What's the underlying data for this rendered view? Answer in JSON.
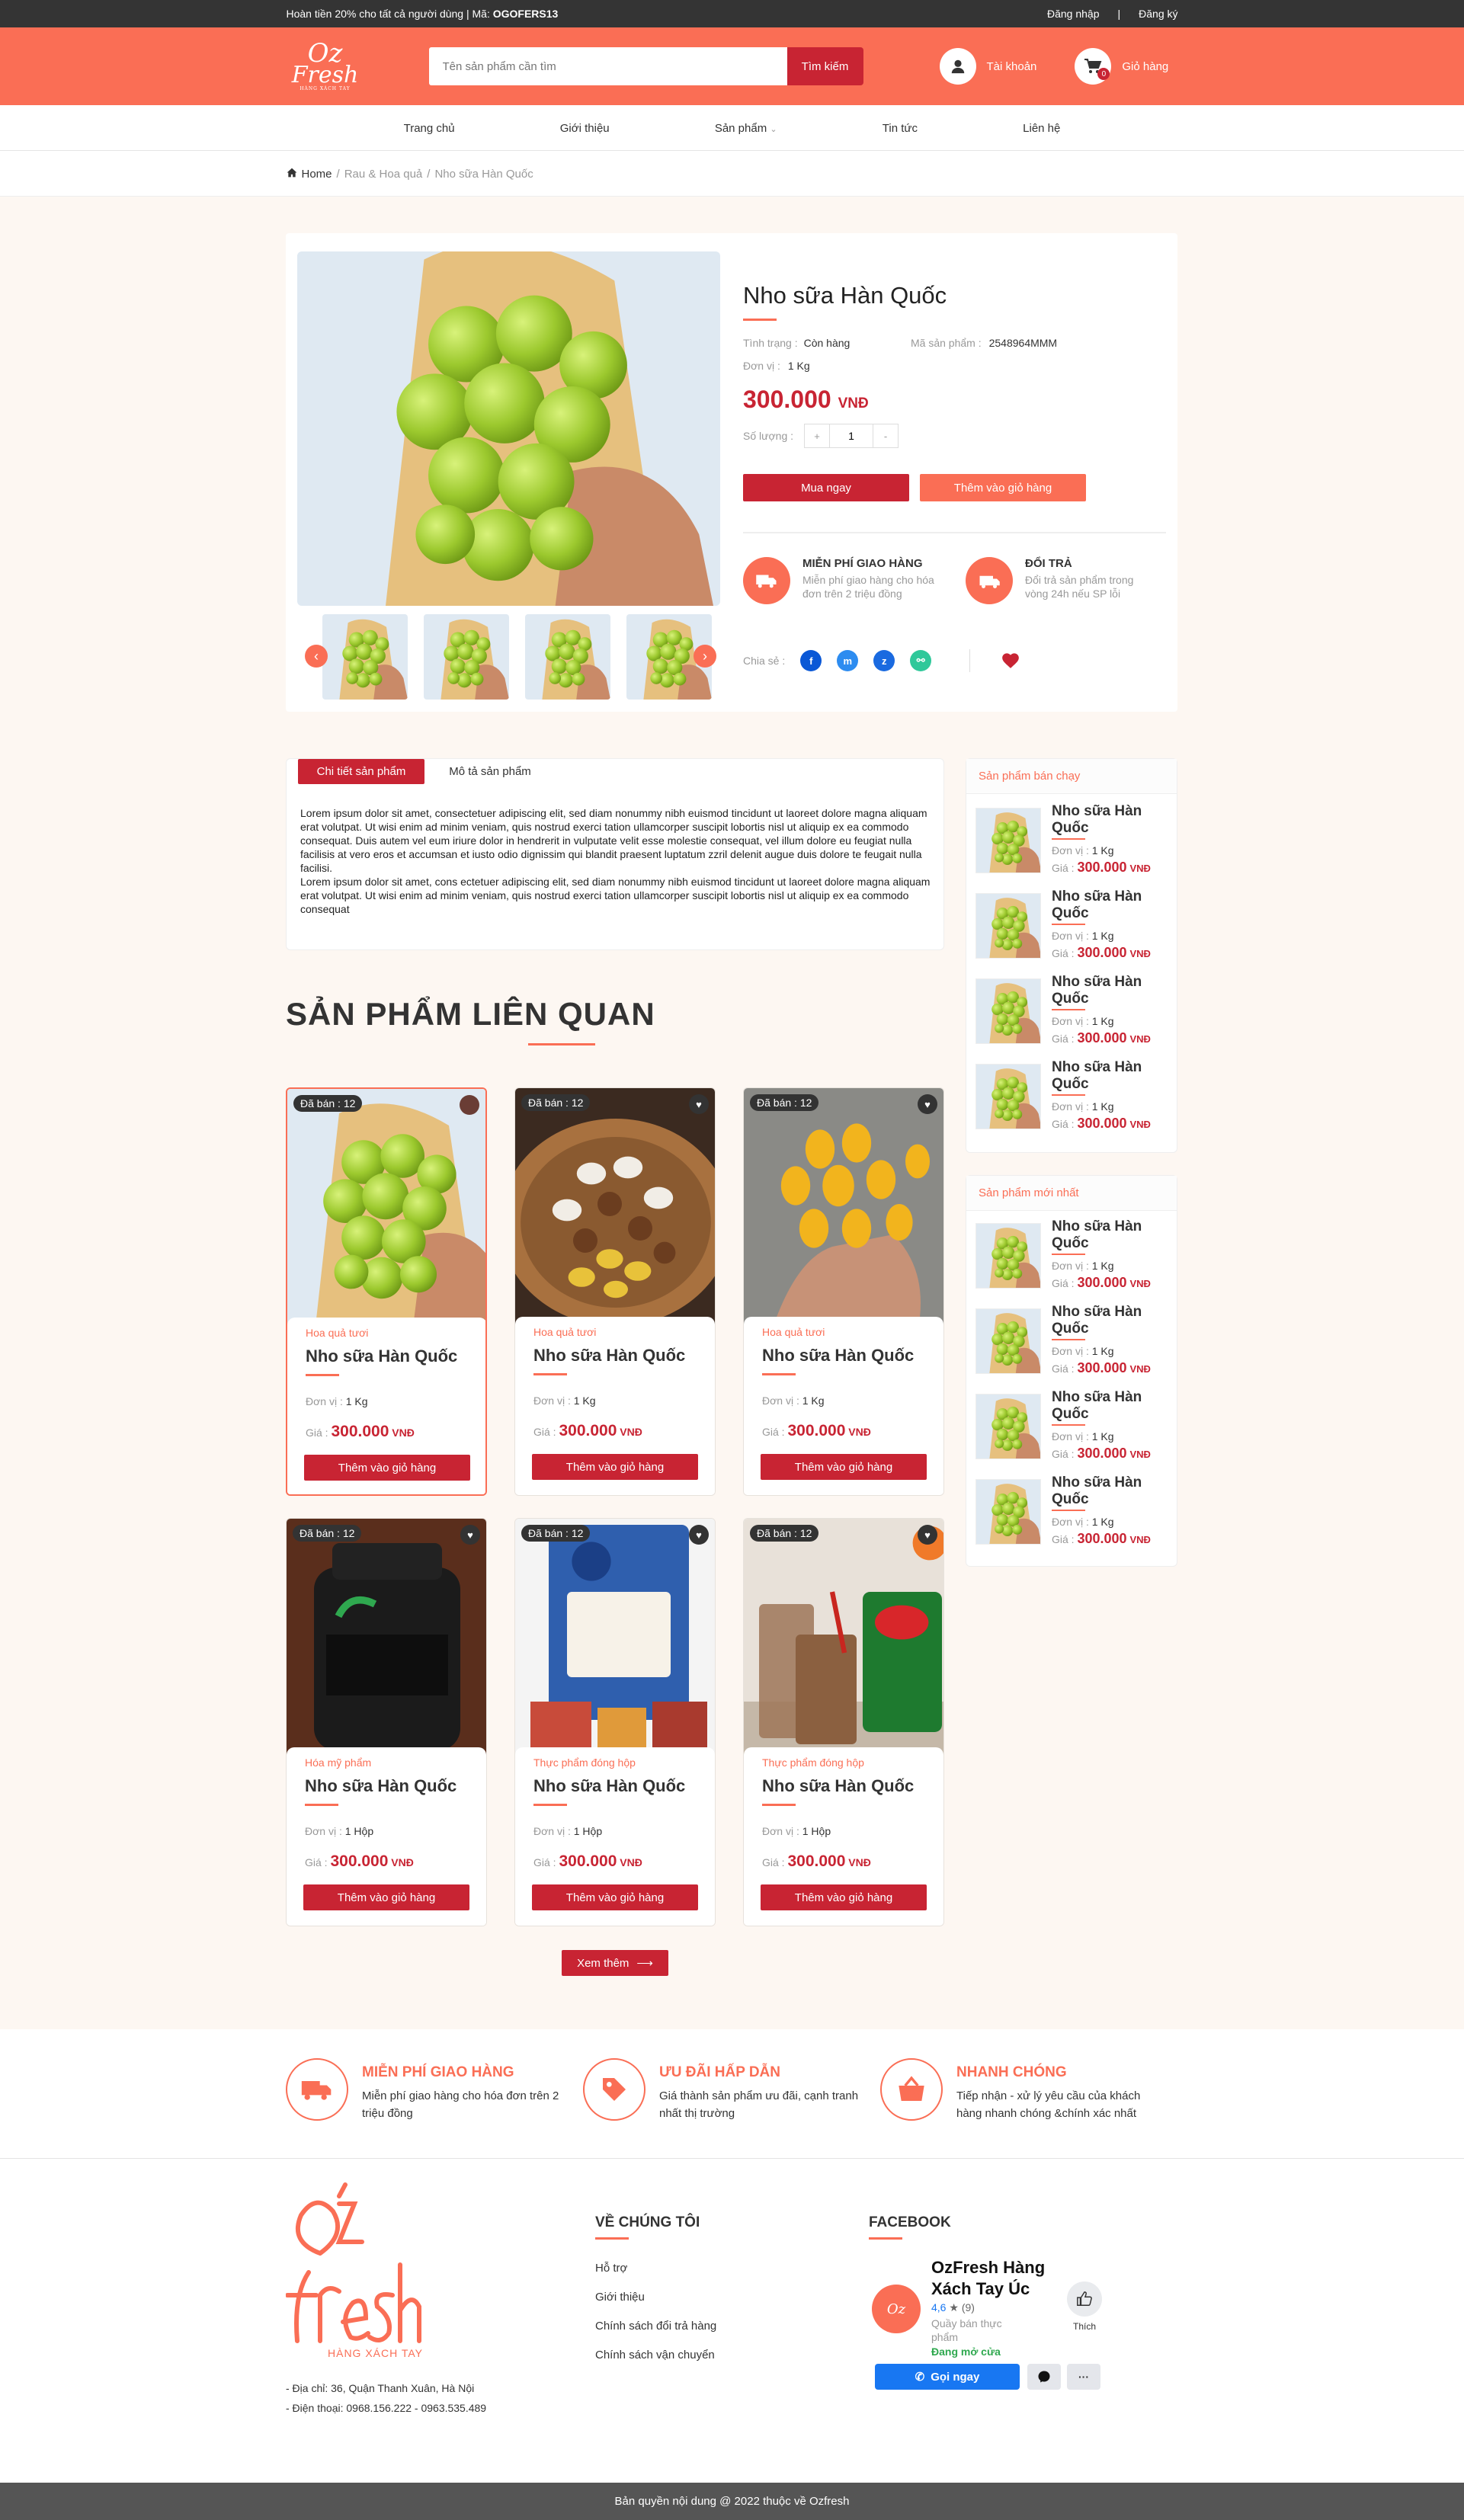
{
  "topbar": {
    "promo_text": "Hoàn tiền 20% cho tất cả người dùng | Mã: ",
    "promo_code": "OGOFERS13",
    "login": "Đăng nhập",
    "separator": "|",
    "register": "Đăng ký"
  },
  "header": {
    "logo_oz": "Oz",
    "logo_fresh": "Fresh",
    "logo_tag": "HÀNG XÁCH TAY",
    "search_placeholder": "Tên sản phẩm cần tìm",
    "search_button": "Tìm kiếm",
    "account": "Tài khoản",
    "cart": "Giỏ hàng",
    "cart_count": "0"
  },
  "nav": {
    "items": [
      "Trang chủ",
      "Giới thiệu",
      "Sản phẩm",
      "Tin tức",
      "Liên hệ"
    ],
    "dropdown_caret": "⌄"
  },
  "breadcrumb": {
    "home": "Home",
    "sep": "/",
    "category": "Rau & Hoa quả",
    "current": "Nho sữa Hàn Quốc"
  },
  "product": {
    "name": "Nho sữa Hàn Quốc",
    "status_label": "Tình trạng :",
    "status_value": "Còn hàng",
    "sku_label": "Mã sản phẩm :",
    "sku_value": "2548964MMM",
    "unit_label": "Đơn vị :",
    "unit_value": "1 Kg",
    "price": "300.000",
    "currency": "VNĐ",
    "qty_label": "Số lượng :",
    "qty_minus": "+",
    "qty_value": "1",
    "qty_plus": "-",
    "buy_now": "Mua ngay",
    "add_to_cart": "Thêm vào giỏ hàng",
    "feature1_title": "MIỄN PHÍ GIAO HÀNG",
    "feature1_desc": "Miễn phí giao hàng cho hóa đơn trên 2 triệu đồng",
    "feature2_title": "ĐỔI TRẢ",
    "feature2_desc": "Đổi trả sản phẩm trong vòng 24h nếu SP lỗi",
    "share_label": "Chia sẻ :",
    "share_icons": [
      "f",
      "m",
      "z",
      "⚯"
    ]
  },
  "tabs": {
    "detail": "Chi tiết sản phẩm",
    "description": "Mô tả sản phẩm",
    "text": "Lorem ipsum dolor sit amet, consectetuer adipiscing elit, sed diam nonummy nibh euismod tincidunt ut laoreet dolore magna aliquam erat volutpat. Ut wisi enim ad minim veniam, quis nostrud exerci tation ullamcorper suscipit lobortis nisl ut aliquip ex ea commodo consequat. Duis autem vel eum iriure dolor in hendrerit in vulputate velit esse molestie consequat, vel illum dolore eu feugiat nulla facilisis at vero eros et accumsan et iusto odio dignissim qui blandit praesent luptatum zzril delenit augue duis dolore te feugait nulla facilisi.",
    "text2": "Lorem ipsum dolor sit amet, cons ectetuer adipiscing elit, sed diam nonummy nibh euismod tincidunt ut laoreet dolore magna aliquam erat volutpat. Ut wisi enim ad minim veniam, quis nostrud exerci tation ullamcorper suscipit lobortis nisl ut aliquip ex ea commodo consequat"
  },
  "related": {
    "title": "SẢN PHẨM LIÊN QUAN",
    "items": [
      {
        "sold": "Đã bán : 12",
        "category": "Hoa quả tươi",
        "name": "Nho sữa Hàn Quốc",
        "unit_label": "Đơn vị :",
        "unit": "1 Kg",
        "price_label": "Giá :",
        "price": "300.000",
        "currency": "VNĐ",
        "button": "Thêm vào giỏ hàng"
      },
      {
        "sold": "Đã bán : 12",
        "category": "Hoa quả tươi",
        "name": "Nho sữa Hàn Quốc",
        "unit_label": "Đơn vị :",
        "unit": "1 Kg",
        "price_label": "Giá :",
        "price": "300.000",
        "currency": "VNĐ",
        "button": "Thêm vào giỏ hàng"
      },
      {
        "sold": "Đã bán : 12",
        "category": "Hoa quả tươi",
        "name": "Nho sữa Hàn Quốc",
        "unit_label": "Đơn vị :",
        "unit": "1 Kg",
        "price_label": "Giá :",
        "price": "300.000",
        "currency": "VNĐ",
        "button": "Thêm vào giỏ hàng"
      },
      {
        "sold": "Đã bán : 12",
        "category": "Hóa mỹ phẩm",
        "name": "Nho sữa Hàn Quốc",
        "unit_label": "Đơn vị :",
        "unit": "1 Hộp",
        "price_label": "Giá :",
        "price": "300.000",
        "currency": "VNĐ",
        "button": "Thêm vào giỏ hàng"
      },
      {
        "sold": "Đã bán : 12",
        "category": "Thực phẩm đóng hộp",
        "name": "Nho sữa Hàn Quốc",
        "unit_label": "Đơn vị :",
        "unit": "1 Hộp",
        "price_label": "Giá :",
        "price": "300.000",
        "currency": "VNĐ",
        "button": "Thêm vào giỏ hàng"
      },
      {
        "sold": "Đã bán : 12",
        "category": "Thực phẩm đóng hộp",
        "name": "Nho sữa Hàn Quốc",
        "unit_label": "Đơn vị :",
        "unit": "1 Hộp",
        "price_label": "Giá :",
        "price": "300.000",
        "currency": "VNĐ",
        "button": "Thêm vào giỏ hàng"
      }
    ],
    "more": "Xem thêm"
  },
  "sidebar": {
    "bestseller_title": "Sản phẩm bán chạy",
    "newest_title": "Sản phẩm mới nhất",
    "item": {
      "name": "Nho sữa Hàn Quốc",
      "unit_label": "Đơn vị :",
      "unit": "1 Kg",
      "price_label": "Giá :",
      "price": "300.000",
      "currency": "VNĐ"
    }
  },
  "services": [
    {
      "title": "MIỄN PHÍ GIAO HÀNG",
      "desc": "Miễn phí giao hàng cho hóa đơn trên 2 triệu đồng"
    },
    {
      "title": "ƯU ĐÃI HẤP DẪN",
      "desc": "Giá thành sản phẩm ưu đãi, cạnh tranh nhất thị trường"
    },
    {
      "title": "NHANH CHÓNG",
      "desc": "Tiếp nhận - xử lý yêu cầu của khách hàng nhanh chóng &chính xác nhất"
    }
  ],
  "footer": {
    "logo_tag": "HÀNG XÁCH TAY",
    "address": "- Địa chỉ: 36, Quận Thanh Xuân, Hà Nội",
    "phone": "- Điện thoại: 0968.156.222 - 0963.535.489",
    "about_title": "VỀ CHÚNG TÔI",
    "about_links": [
      "Hỗ trợ",
      "Giới thiệu",
      "Chính sách đổi trả hàng",
      "Chính sách vận chuyển"
    ],
    "facebook_title": "FACEBOOK",
    "fb_page": "OzFresh Hàng Xách Tay Úc",
    "fb_rating": "4,6",
    "fb_star": "★",
    "fb_reviews": "(9)",
    "fb_type": "Quầy bán thực phẩm",
    "fb_open": "Đang mở cửa",
    "fb_like": "Thích",
    "fb_call": "Gọi ngay",
    "fb_more": "···",
    "copyright": "Bản quyền nội dung @ 2022 thuộc về Ozfresh"
  },
  "colors": {
    "accent": "#fa6e55",
    "red": "#c82433",
    "dark": "#343434",
    "bg": "#fdf7f2"
  }
}
